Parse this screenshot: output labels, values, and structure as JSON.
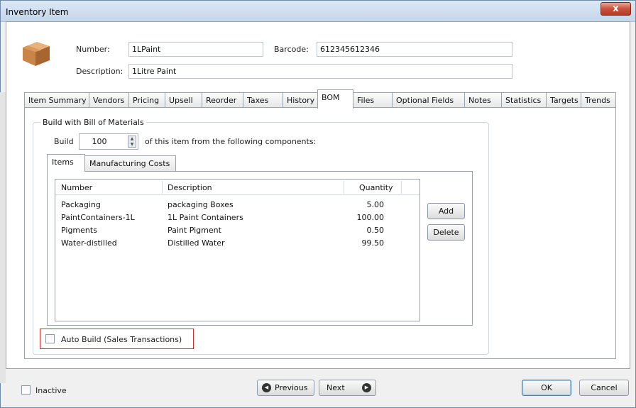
{
  "window": {
    "title": "Inventory Item",
    "close_label": "x"
  },
  "header": {
    "number_label": "Number:",
    "number_value": "1LPaint",
    "barcode_label": "Barcode:",
    "barcode_value": "612345612346",
    "description_label": "Description:",
    "description_value": "1Litre Paint"
  },
  "tabs": [
    "Item Summary",
    "Vendors",
    "Pricing",
    "Upsell",
    "Reorder",
    "Taxes",
    "History",
    "BOM",
    "Files",
    "Optional Fields",
    "Notes",
    "Statistics",
    "Targets",
    "Trends"
  ],
  "active_tab": "BOM",
  "bom": {
    "group_title": "Build with Bill of Materials",
    "build_label": "Build",
    "build_qty": "100",
    "build_suffix": "of this item from the following components:",
    "subtabs": [
      "Items",
      "Manufacturing Costs"
    ],
    "active_subtab": "Items",
    "columns": [
      "Number",
      "Description",
      "Quantity"
    ],
    "rows": [
      {
        "number": "Packaging",
        "description": "packaging Boxes",
        "quantity": "5.00"
      },
      {
        "number": "PaintContainers-1L",
        "description": "1L Paint Containers",
        "quantity": "100.00"
      },
      {
        "number": "Pigments",
        "description": "Paint Pigment",
        "quantity": "0.50"
      },
      {
        "number": "Water-distilled",
        "description": "Distilled Water",
        "quantity": "99.50"
      }
    ],
    "add_label": "Add",
    "delete_label": "Delete",
    "auto_build_label": "Auto Build (Sales Transactions)",
    "auto_build_checked": false
  },
  "footer": {
    "inactive_label": "Inactive",
    "previous_label": "Previous",
    "next_label": "Next",
    "ok_label": "OK",
    "cancel_label": "Cancel"
  },
  "colors": {
    "highlight_border": "#d42c2c",
    "close_button": "#c8503c"
  }
}
